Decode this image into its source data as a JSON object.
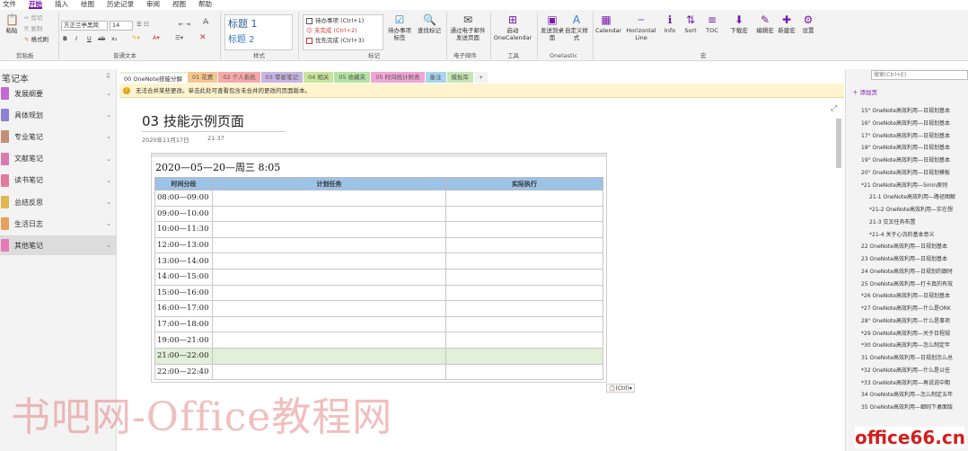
{
  "menu": [
    "文件",
    "开始",
    "插入",
    "绘图",
    "历史记录",
    "审阅",
    "视图",
    "帮助"
  ],
  "ribbon": {
    "clipboard": {
      "paste": "粘贴",
      "cut": "剪切",
      "copy": "复制",
      "format_painter": "格式刷",
      "label": "剪贴板"
    },
    "font": {
      "family": "方正兰亭黑简",
      "size": "14",
      "bold": "B",
      "italic": "I",
      "underline": "U",
      "strike": "ab",
      "subscript": "x₂",
      "label": "普通文本"
    },
    "styles": {
      "h1": "标题 1",
      "h2": "标题 2",
      "label": "样式"
    },
    "tags": {
      "todo": "待办事项 (Ctrl+1)",
      "unfinished": "未完成 (Ctrl+2)",
      "priority": "优先完成 (Ctrl+3)",
      "todo_tag": "待办事项标签",
      "find_tags": "查找标记",
      "label": "标记"
    },
    "email": {
      "send": "通过电子邮件发送页面",
      "label": "电子邮件"
    },
    "tools": {
      "launch": "启动 OneCalendar",
      "label": "工具"
    },
    "onetastic": {
      "send_desktop": "发送到桌面",
      "custom_style": "自定义样式",
      "label": "Onetastic"
    },
    "macros": {
      "items": [
        "Calendar",
        "Horizontal Line",
        "Info",
        "Sort",
        "TOC",
        "下载宏",
        "编辑宏",
        "新建宏",
        "设置"
      ],
      "label": "宏"
    }
  },
  "notebooks": {
    "title": "笔记本",
    "items": [
      {
        "label": "发展纲要",
        "color": "#c46bd1"
      },
      {
        "label": "具体规划",
        "color": "#8c7fd6"
      },
      {
        "label": "专业笔记",
        "color": "#c48f75"
      },
      {
        "label": "文献笔记",
        "color": "#d97bb0"
      },
      {
        "label": "读书笔记",
        "color": "#e27a9f"
      },
      {
        "label": "总结反思",
        "color": "#e0b74f"
      },
      {
        "label": "生活日志",
        "color": "#e8a05a"
      },
      {
        "label": "其他笔记",
        "color": "#e67ab7"
      }
    ]
  },
  "tabs": [
    {
      "label": "00 OneNote技能分解",
      "color": "#e2efd9",
      "active": true
    },
    {
      "label": "01 花费",
      "color": "#f7c58e"
    },
    {
      "label": "02 个人系统",
      "color": "#f5a9a9"
    },
    {
      "label": "03 零星笔记",
      "color": "#c9b3e3"
    },
    {
      "label": "04 相关",
      "color": "#c7e49a"
    },
    {
      "label": "05 收藏夹",
      "color": "#b5e3a3"
    },
    {
      "label": "05 时间统计附表",
      "color": "#f2a6d6"
    },
    {
      "label": "备注",
      "color": "#a8d5ef"
    },
    {
      "label": "模板库",
      "color": "#c6e7b5"
    },
    {
      "label": "+",
      "color": "#f3f3f3"
    }
  ],
  "infobar": "无法合并某些更改。单击此处可查看包含未合并的更改的页面版本。",
  "page": {
    "title": "03 技能示例页面",
    "date": "2020年11月17日",
    "time": "21:37",
    "heading": "2020—05—20—周三 8:05",
    "table": {
      "headers": [
        "时间分段",
        "计划任务",
        "实际执行"
      ],
      "rows": [
        "08:00—09:00",
        "09:00—10:00",
        "10:00—11:30",
        "12:00—13:00",
        "13:00—14:00",
        "14:00—15:00",
        "15:00—16:00",
        "16:00—17:00",
        "17:00—18:00",
        "19:00—21:00",
        "21:00—22:00",
        "22:00—22:40"
      ],
      "highlight_row": 10
    },
    "paste_hint": "(Ctrl)"
  },
  "right": {
    "search_placeholder": "搜索(Ctrl+E)",
    "add_page": "添加页",
    "pages": [
      {
        "label": "15° OneNote高效利用—日规划基本",
        "sub": false
      },
      {
        "label": "16° OneNote高效利用—日规划基本",
        "sub": false
      },
      {
        "label": "17° OneNote高效利用—日规划基本",
        "sub": false
      },
      {
        "label": "18° OneNote高效利用—日规划基本",
        "sub": false
      },
      {
        "label": "19° OneNote高效利用—日规划基本",
        "sub": false
      },
      {
        "label": "20° OneNote高效利用—日规划模板",
        "sub": false
      },
      {
        "label": "*21 OneNote高效利用—5min原则",
        "sub": false
      },
      {
        "label": "21-1 OneNote高效利用—路径图解",
        "sub": true
      },
      {
        "label": "*21-2 OneNote高效利用—实在想",
        "sub": true
      },
      {
        "label": "21-3 交叉任务布置",
        "sub": true
      },
      {
        "label": "*21-4 关于心流的基本意义",
        "sub": true
      },
      {
        "label": "22 OneNote高效利用—日规划基本",
        "sub": false
      },
      {
        "label": "23 OneNote高效利用—日规划基本",
        "sub": false
      },
      {
        "label": "24 OneNote高效利用—日规划的跟时",
        "sub": false
      },
      {
        "label": "25 OneNote高效利用—打卡真的有效",
        "sub": false
      },
      {
        "label": "*26 OneNote高效利用—日规划基本",
        "sub": false
      },
      {
        "label": "*27 OneNote高效利用—什么是ORK",
        "sub": false
      },
      {
        "label": "28° OneNote高效利用—什么是事项",
        "sub": false
      },
      {
        "label": "*29 OneNote高效利用—关于日程规",
        "sub": false
      },
      {
        "label": "*30 OneNote高效利用—怎么制定年",
        "sub": false
      },
      {
        "label": "31 OneNote高效利用—日规划怎么总",
        "sub": false
      },
      {
        "label": "*32 OneNote高效利用—什么是以任",
        "sub": false
      },
      {
        "label": "*33 OneNote高效利用—再说说中期",
        "sub": false
      },
      {
        "label": "34 OneNote高效利用—怎么制定五年",
        "sub": false
      },
      {
        "label": "35 OneNote高效利用—细则下桌面版",
        "sub": false
      }
    ]
  },
  "watermark": "书吧网-Office教程网",
  "logo": "office66.cn"
}
